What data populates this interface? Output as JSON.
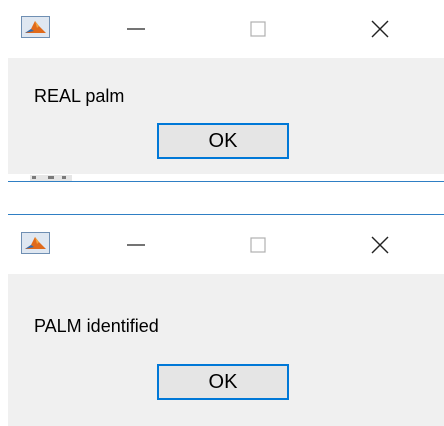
{
  "dialogs": [
    {
      "message": "REAL palm",
      "ok_label": "OK",
      "icons": {
        "app": "matlab-icon",
        "minimize": "minimize-icon",
        "maximize": "maximize-icon",
        "close": "close-icon"
      }
    },
    {
      "message": "PALM identified",
      "ok_label": "OK",
      "icons": {
        "app": "matlab-icon",
        "minimize": "minimize-icon",
        "maximize": "maximize-icon",
        "close": "close-icon"
      }
    }
  ],
  "colors": {
    "accent": "#0078d7",
    "separator": "#2f7fc4",
    "client_background": "#f0f0f0",
    "button_face": "#e5e5e5"
  }
}
